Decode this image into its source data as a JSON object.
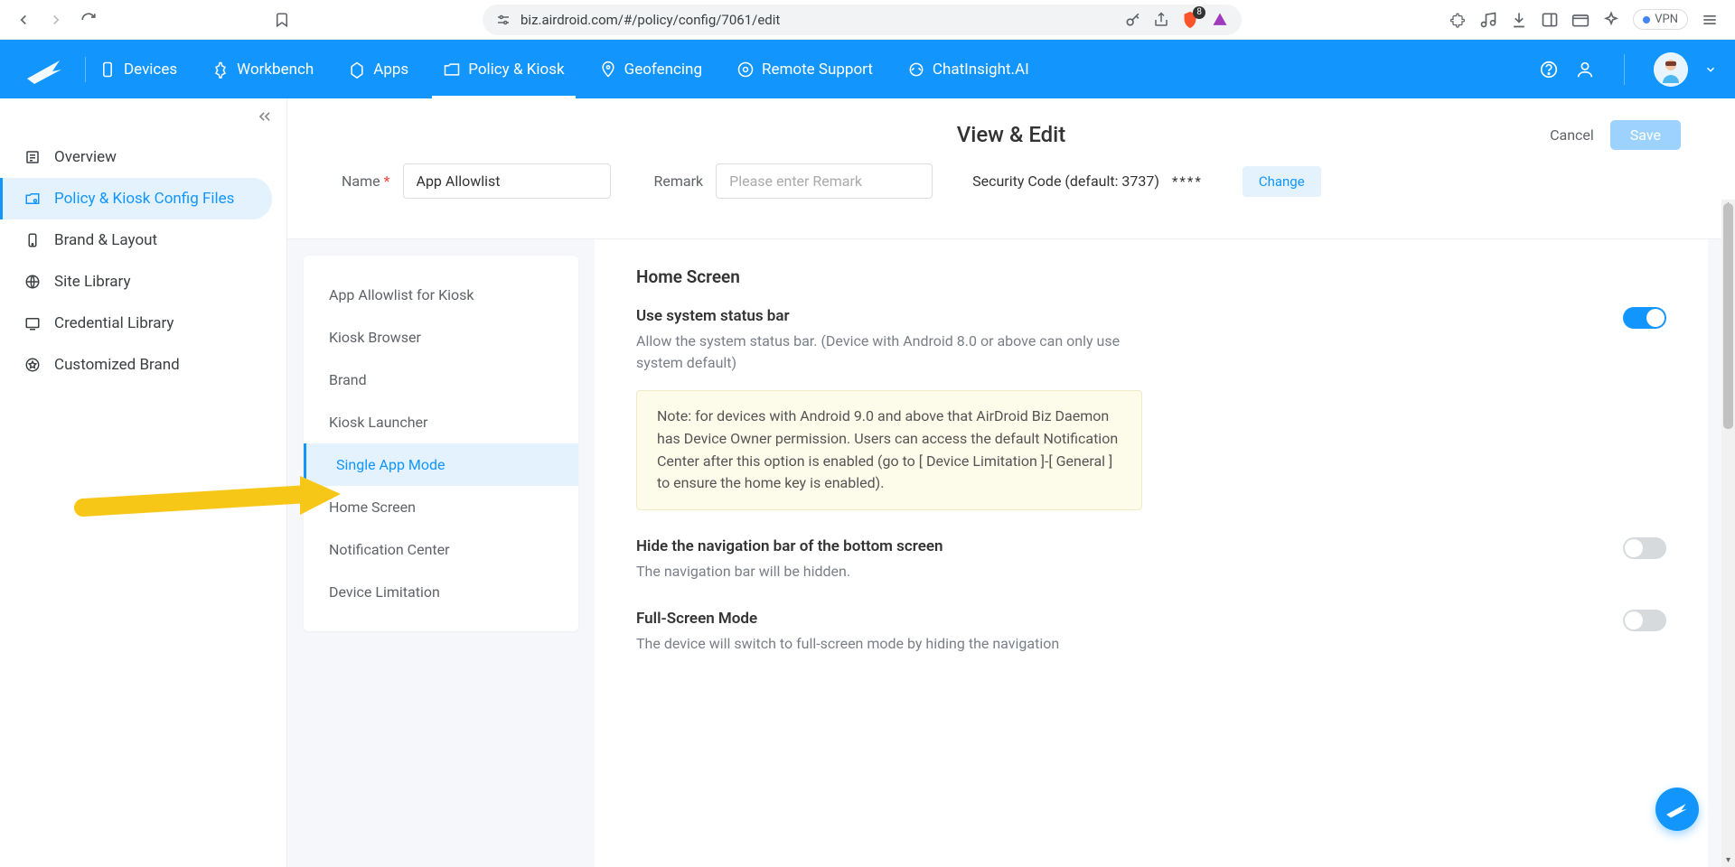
{
  "browser": {
    "url": "biz.airdroid.com/#/policy/config/7061/edit",
    "badge": "8",
    "vpn": "VPN"
  },
  "topnav": {
    "items": [
      "Devices",
      "Workbench",
      "Apps",
      "Policy & Kiosk",
      "Geofencing",
      "Remote Support",
      "ChatInsight.AI"
    ]
  },
  "sidebar": {
    "items": [
      "Overview",
      "Policy & Kiosk Config Files",
      "Brand & Layout",
      "Site Library",
      "Credential Library",
      "Customized Brand"
    ]
  },
  "page": {
    "title": "View & Edit",
    "cancel": "Cancel",
    "save": "Save"
  },
  "form": {
    "name_label": "Name",
    "name_value": "App Allowlist",
    "remark_label": "Remark",
    "remark_placeholder": "Please enter Remark",
    "security_label": "Security Code (default: 3737)",
    "security_mask": "****",
    "change": "Change"
  },
  "inner_sidebar": {
    "items": [
      "App Allowlist for Kiosk",
      "Kiosk Browser",
      "Brand",
      "Kiosk Launcher",
      "Single App Mode",
      "Home Screen",
      "Notification Center",
      "Device Limitation"
    ]
  },
  "section": {
    "title": "Home Screen",
    "s1_title": "Use system status bar",
    "s1_desc": "Allow the system status bar. (Device with Android 8.0 or above can only use system default)",
    "s1_note": "Note: for devices with Android 9.0 and above that AirDroid Biz Daemon has Device Owner permission. Users can access the default Notification Center after this option is enabled (go to [ Device Limitation ]-[ General ] to ensure the home key is enabled).",
    "s2_title": "Hide the navigation bar of the bottom screen",
    "s2_desc": "The navigation bar will be hidden.",
    "s3_title": "Full-Screen Mode",
    "s3_desc": "The device will switch to full-screen mode by hiding the navigation"
  }
}
